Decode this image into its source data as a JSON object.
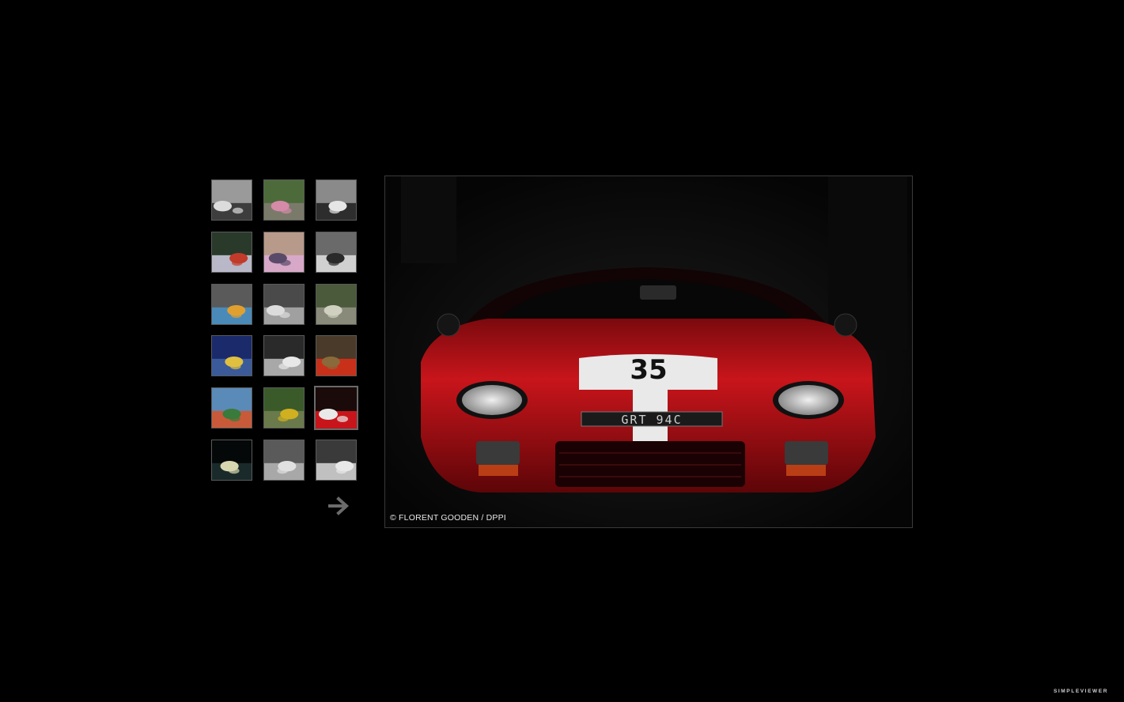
{
  "gallery": {
    "thumbnails": [
      {
        "name": "thumb-le-mans-start-bw",
        "selected": false
      },
      {
        "name": "thumb-track-pink-car",
        "selected": false
      },
      {
        "name": "thumb-heures-du-mans-vintage",
        "selected": false
      },
      {
        "name": "thumb-cars-in-forest",
        "selected": false
      },
      {
        "name": "thumb-couple-on-car",
        "selected": false
      },
      {
        "name": "thumb-number-8-bw",
        "selected": false
      },
      {
        "name": "thumb-gulf-racecar",
        "selected": false
      },
      {
        "name": "thumb-grid-start-bw",
        "selected": false
      },
      {
        "name": "thumb-cockpit",
        "selected": false
      },
      {
        "name": "thumb-night-sky-track",
        "selected": false
      },
      {
        "name": "thumb-speeding-car-bw",
        "selected": false
      },
      {
        "name": "thumb-red-car-blur",
        "selected": false
      },
      {
        "name": "thumb-crowd-colorful",
        "selected": false
      },
      {
        "name": "thumb-green-blur",
        "selected": false
      },
      {
        "name": "thumb-red-gt40",
        "selected": true
      },
      {
        "name": "thumb-night-lights",
        "selected": false
      },
      {
        "name": "thumb-rain-spray-bw",
        "selected": false
      },
      {
        "name": "thumb-exhaust-pipes",
        "selected": false
      }
    ]
  },
  "main_image": {
    "caption": "© FLORENT GOODEN / DPPI",
    "plate": "GRT 94C",
    "race_number": "35",
    "car_color": "#c8151b"
  },
  "footer": {
    "brand": "SIMPLEVIEWER"
  }
}
